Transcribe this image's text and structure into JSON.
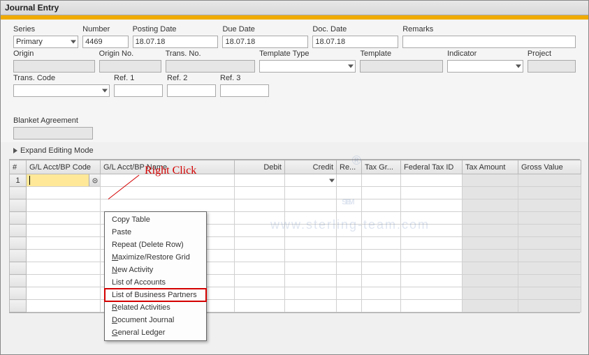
{
  "window": {
    "title": "Journal Entry"
  },
  "header": {
    "series": {
      "label": "Series",
      "value": "Primary"
    },
    "number": {
      "label": "Number",
      "value": "4469"
    },
    "posting_date": {
      "label": "Posting Date",
      "value": "18.07.18"
    },
    "due_date": {
      "label": "Due Date",
      "value": "18.07.18"
    },
    "doc_date": {
      "label": "Doc. Date",
      "value": "18.07.18"
    },
    "remarks": {
      "label": "Remarks",
      "value": ""
    },
    "origin": {
      "label": "Origin",
      "value": ""
    },
    "origin_no": {
      "label": "Origin No.",
      "value": ""
    },
    "trans_no": {
      "label": "Trans. No.",
      "value": ""
    },
    "template_type": {
      "label": "Template Type",
      "value": ""
    },
    "template": {
      "label": "Template",
      "value": ""
    },
    "indicator": {
      "label": "Indicator",
      "value": ""
    },
    "project": {
      "label": "Project",
      "value": ""
    },
    "trans_code": {
      "label": "Trans. Code",
      "value": ""
    },
    "ref1": {
      "label": "Ref. 1",
      "value": ""
    },
    "ref2": {
      "label": "Ref. 2",
      "value": ""
    },
    "ref3": {
      "label": "Ref. 3",
      "value": ""
    }
  },
  "blanket": {
    "label": "Blanket Agreement",
    "value": ""
  },
  "expand": {
    "label": "Expand Editing Mode"
  },
  "grid": {
    "columns": {
      "rownum": "#",
      "code": "G/L Acct/BP Code",
      "name": "G/L Acct/BP Name",
      "debit": "Debit",
      "credit": "Credit",
      "re": "Re...",
      "taxgr": "Tax Gr...",
      "fedtax": "Federal Tax ID",
      "taxamt": "Tax Amount",
      "gross": "Gross Value"
    },
    "rows": [
      {
        "num": "1",
        "code": "",
        "name": "",
        "debit": "",
        "credit": "",
        "re": "",
        "taxgr": "",
        "fedtax": "",
        "taxamt": "",
        "gross": ""
      }
    ]
  },
  "context_menu": {
    "items": [
      {
        "text": "Copy Table",
        "ul": ""
      },
      {
        "text": "Paste",
        "ul": ""
      },
      {
        "text": "Repeat (Delete Row)",
        "ul": ""
      },
      {
        "text": "Maximize/Restore Grid",
        "ul": "M"
      },
      {
        "text": "New Activity",
        "ul": "N"
      },
      {
        "text": "List of Accounts",
        "ul": ""
      },
      {
        "text": "List of Business Partners",
        "ul": "",
        "highlight": true
      },
      {
        "text": "Related Activities",
        "ul": "R"
      },
      {
        "text": "Document Journal",
        "ul": "D"
      },
      {
        "text": "General Ledger",
        "ul": "G"
      }
    ]
  },
  "annotation": {
    "text": "Right Click"
  },
  "watermark": {
    "logo": "STEM",
    "reg": "®",
    "url": "www.sterling-team.com"
  }
}
